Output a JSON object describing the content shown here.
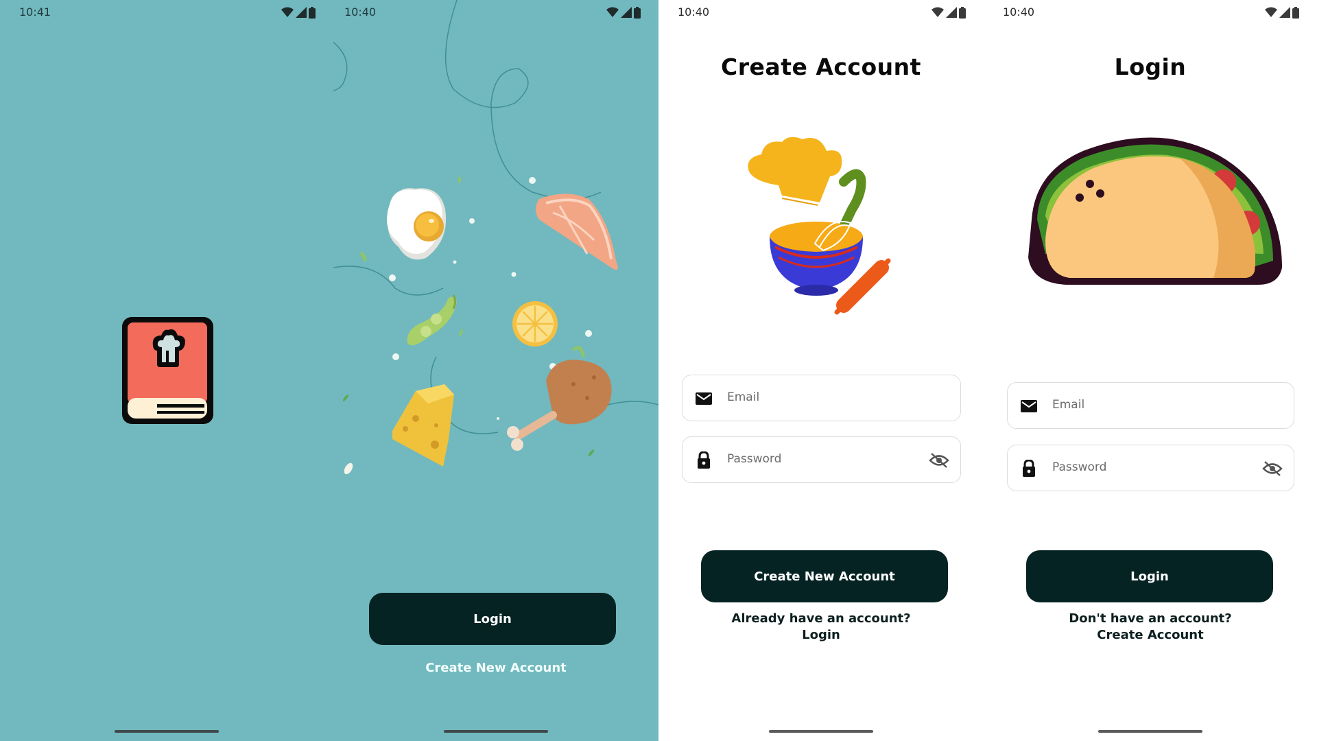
{
  "status": {
    "splash_time": "10:41",
    "other_time": "10:40"
  },
  "welcome": {
    "login_label": "Login",
    "create_label": "Create New Account"
  },
  "create_account": {
    "title": "Create Account",
    "email_placeholder": "Email",
    "password_placeholder": "Password",
    "submit_label": "Create New Account",
    "prompt": "Already have an account?",
    "link": "Login"
  },
  "login": {
    "title": "Login",
    "email_placeholder": "Email",
    "password_placeholder": "Password",
    "submit_label": "Login",
    "prompt": "Don't have an account?",
    "link": "Create Account"
  },
  "icons": {
    "logo": "chef-cookbook-icon",
    "email": "mail-icon",
    "password": "lock-icon",
    "visibility": "eye-off-icon",
    "wifi": "wifi-icon",
    "signal": "signal-icon",
    "battery": "battery-icon"
  },
  "colors": {
    "teal_background": "#71b9be",
    "button_dark": "#062323",
    "logo_red": "#f26b5b"
  }
}
